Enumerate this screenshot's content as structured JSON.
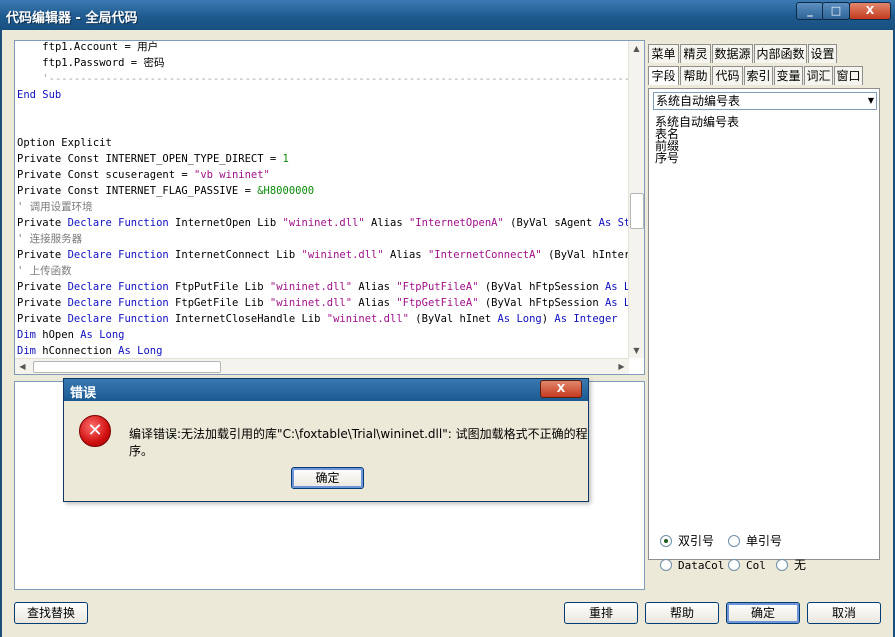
{
  "window": {
    "title": "代码编辑器 - 全局代码",
    "buttons": {
      "minimize": "_",
      "maximize": "□",
      "close": "X"
    }
  },
  "code": {
    "lines": [
      {
        "indent": "    ",
        "segments": [
          {
            "t": "ftp1.Account = 用户",
            "c": ""
          }
        ]
      },
      {
        "indent": "    ",
        "segments": [
          {
            "t": "ftp1.Password = 密码",
            "c": ""
          }
        ]
      },
      {
        "indent": "    ",
        "segments": [
          {
            "t": "'---------------------------------------------------------------------------------------------------------------------",
            "c": "dash"
          }
        ]
      },
      {
        "indent": "",
        "segments": [
          {
            "t": "End Sub",
            "c": "kw"
          }
        ]
      },
      {
        "indent": "",
        "segments": []
      },
      {
        "indent": "",
        "segments": []
      },
      {
        "indent": "",
        "segments": [
          {
            "t": "Option Explicit",
            "c": ""
          }
        ]
      },
      {
        "indent": "",
        "segments": [
          {
            "t": "Private Const INTERNET_OPEN_TYPE_DIRECT = ",
            "c": ""
          },
          {
            "t": "1",
            "c": "num"
          }
        ]
      },
      {
        "indent": "",
        "segments": [
          {
            "t": "Private Const scuseragent = ",
            "c": ""
          },
          {
            "t": "\"vb wininet\"",
            "c": "str"
          }
        ]
      },
      {
        "indent": "",
        "segments": [
          {
            "t": "Private Const INTERNET_FLAG_PASSIVE = ",
            "c": ""
          },
          {
            "t": "&H8000000",
            "c": "num"
          }
        ]
      },
      {
        "indent": "",
        "segments": [
          {
            "t": "' 调用设置环境",
            "c": "cmt"
          }
        ]
      },
      {
        "indent": "",
        "segments": [
          {
            "t": "Private ",
            "c": ""
          },
          {
            "t": "Declare Function",
            "c": "kw"
          },
          {
            "t": " InternetOpen Lib ",
            "c": ""
          },
          {
            "t": "\"wininet.dll\"",
            "c": "str"
          },
          {
            "t": " Alias ",
            "c": ""
          },
          {
            "t": "\"InternetOpenA\"",
            "c": "str"
          },
          {
            "t": " (ByVal sAgent ",
            "c": ""
          },
          {
            "t": "As String",
            "c": "kw"
          },
          {
            "t": ",",
            "c": ""
          }
        ]
      },
      {
        "indent": "",
        "segments": [
          {
            "t": "' 连接服务器",
            "c": "cmt"
          }
        ]
      },
      {
        "indent": "",
        "segments": [
          {
            "t": "Private ",
            "c": ""
          },
          {
            "t": "Declare Function",
            "c": "kw"
          },
          {
            "t": " InternetConnect Lib ",
            "c": ""
          },
          {
            "t": "\"wininet.dll\"",
            "c": "str"
          },
          {
            "t": " Alias ",
            "c": ""
          },
          {
            "t": "\"InternetConnectA\"",
            "c": "str"
          },
          {
            "t": " (ByVal hInternetSe",
            "c": ""
          }
        ]
      },
      {
        "indent": "",
        "segments": [
          {
            "t": "' 上传函数",
            "c": "cmt"
          }
        ]
      },
      {
        "indent": "",
        "segments": [
          {
            "t": "Private ",
            "c": ""
          },
          {
            "t": "Declare Function",
            "c": "kw"
          },
          {
            "t": " FtpPutFile Lib ",
            "c": ""
          },
          {
            "t": "\"wininet.dll\"",
            "c": "str"
          },
          {
            "t": " Alias ",
            "c": ""
          },
          {
            "t": "\"FtpPutFileA\"",
            "c": "str"
          },
          {
            "t": " (ByVal hFtpSession ",
            "c": ""
          },
          {
            "t": "As Long",
            "c": "kw"
          },
          {
            "t": ",",
            "c": ""
          }
        ]
      },
      {
        "indent": "",
        "segments": [
          {
            "t": "Private ",
            "c": ""
          },
          {
            "t": "Declare Function",
            "c": "kw"
          },
          {
            "t": " FtpGetFile Lib ",
            "c": ""
          },
          {
            "t": "\"wininet.dll\"",
            "c": "str"
          },
          {
            "t": " Alias ",
            "c": ""
          },
          {
            "t": "\"FtpGetFileA\"",
            "c": "str"
          },
          {
            "t": " (ByVal hFtpSession ",
            "c": ""
          },
          {
            "t": "As Long",
            "c": "kw"
          },
          {
            "t": ",",
            "c": ""
          }
        ]
      },
      {
        "indent": "",
        "segments": [
          {
            "t": "Private ",
            "c": ""
          },
          {
            "t": "Declare Function",
            "c": "kw"
          },
          {
            "t": " InternetCloseHandle Lib ",
            "c": ""
          },
          {
            "t": "\"wininet.dll\"",
            "c": "str"
          },
          {
            "t": " (ByVal hInet ",
            "c": ""
          },
          {
            "t": "As Long",
            "c": "kw"
          },
          {
            "t": ") ",
            "c": ""
          },
          {
            "t": "As Integer",
            "c": "kw"
          }
        ]
      },
      {
        "indent": "",
        "segments": [
          {
            "t": "Dim",
            "c": "kw"
          },
          {
            "t": " hOpen ",
            "c": ""
          },
          {
            "t": "As Long",
            "c": "kw"
          }
        ]
      },
      {
        "indent": "",
        "segments": [
          {
            "t": "Dim",
            "c": "kw"
          },
          {
            "t": " hConnection ",
            "c": ""
          },
          {
            "t": "As Long",
            "c": "kw"
          }
        ]
      }
    ]
  },
  "tabs_row1": [
    "菜单",
    "精灵",
    "数据源",
    "内部函数",
    "设置"
  ],
  "tabs_row2": [
    "字段",
    "帮助",
    "代码",
    "索引",
    "变量",
    "词汇",
    "窗口"
  ],
  "active_tab": "字段",
  "field_panel": {
    "combo_value": "系统自动编号表",
    "items": [
      "系统自动编号表",
      "表名",
      "前缀",
      "序号"
    ]
  },
  "quote_options": [
    {
      "label": "双引号",
      "checked": true
    },
    {
      "label": "单引号",
      "checked": false
    }
  ],
  "insert_options": [
    {
      "label": "DataCol",
      "checked": false
    },
    {
      "label": "Col",
      "checked": false
    },
    {
      "label": "无",
      "checked": false
    }
  ],
  "bottom_buttons": {
    "find_replace": "查找替换",
    "rearrange": "重排",
    "help": "帮助",
    "ok": "确定",
    "cancel": "取消"
  },
  "error_dialog": {
    "title": "错误",
    "message": "编译错误:无法加载引用的库\"C:\\foxtable\\Trial\\wininet.dll\": 试图加载格式不正确的程序。",
    "ok_label": "确定",
    "close": "X"
  },
  "colors": {
    "titlebar": "#1f5a8f",
    "keyword": "#1010c0",
    "string": "#a0108a",
    "number": "#0a8a0a",
    "comment": "#7a7a7a",
    "error_icon": "#d01010"
  }
}
